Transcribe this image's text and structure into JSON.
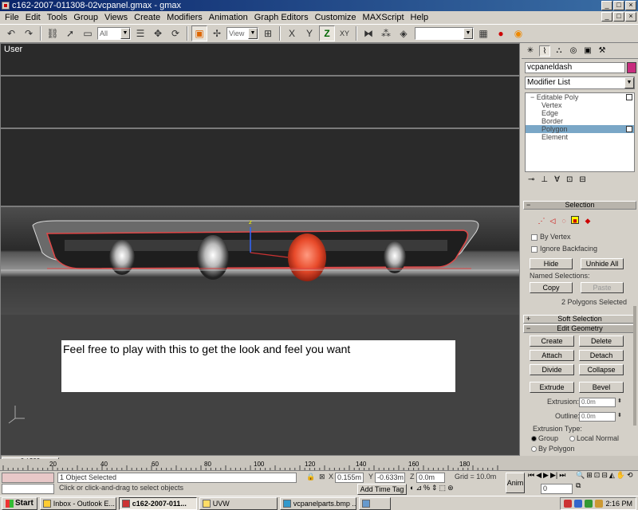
{
  "window": {
    "title": "c162-2007-011308-02vcpanel.gmax - gmax",
    "btn_min": "_",
    "btn_max": "□",
    "btn_close": "×"
  },
  "menu": [
    "File",
    "Edit",
    "Tools",
    "Group",
    "Views",
    "Create",
    "Modifiers",
    "Animation",
    "Graph Editors",
    "Customize",
    "MAXScript",
    "Help"
  ],
  "toolbar": {
    "selection_filter": "All",
    "reference_coord": "View",
    "axis_constraints": [
      "X",
      "Y",
      "Z",
      "XY"
    ]
  },
  "viewport": {
    "label": "User",
    "note": "Feel free to play with this to get the look and feel you want"
  },
  "command_panel": {
    "object_name": "vcpaneldash",
    "object_color": "#c82d7e",
    "modifier_list": "Modifier List",
    "stack": {
      "root": "Editable Poly",
      "items": [
        "Vertex",
        "Edge",
        "Border",
        "Polygon",
        "Element"
      ],
      "selected_item": "Polygon"
    },
    "selection": {
      "title": "Selection",
      "by_vertex": "By Vertex",
      "ignore_backfacing": "Ignore Backfacing",
      "hide": "Hide",
      "unhide_all": "Unhide All",
      "named_selections": "Named Selections:",
      "copy": "Copy",
      "paste": "Paste",
      "status": "2 Polygons Selected"
    },
    "soft_selection": {
      "title": "Soft Selection"
    },
    "edit_geometry": {
      "title": "Edit Geometry",
      "create": "Create",
      "delete": "Delete",
      "attach": "Attach",
      "detach": "Detach",
      "divide": "Divide",
      "collapse": "Collapse",
      "extrude": "Extrude",
      "bevel": "Bevel",
      "extrusion_label": "Extrusion:",
      "extrusion_value": "0.0m",
      "outline_label": "Outline:",
      "outline_value": "0.0m",
      "extrusion_type": "Extrusion Type:",
      "group": "Group",
      "local_normal": "Local Normal",
      "by_polygon": "By Polygon"
    }
  },
  "timeline": {
    "slider": "0 / 200",
    "ticks": [
      "20",
      "40",
      "60",
      "80",
      "100",
      "120",
      "140",
      "160",
      "180"
    ]
  },
  "status": {
    "selected": "1 Object Selected",
    "prompt": "Click or click-and-drag to select objects",
    "x_label": "X",
    "x_value": "0.155m",
    "y_label": "Y",
    "y_value": "-0.633m",
    "z_label": "Z",
    "z_value": "0.0m",
    "grid": "Grid = 10.0m",
    "add_time_tag": "Add Time Tag",
    "anim": "Anim",
    "frame": "0"
  },
  "taskbar": {
    "start": "Start",
    "tasks": [
      "Inbox - Outlook E...",
      "c162-2007-011...",
      "UVW",
      "vcpanelparts.bmp ...",
      ""
    ],
    "active_task": "c162-2007-011...",
    "clock": "2:16 PM"
  }
}
